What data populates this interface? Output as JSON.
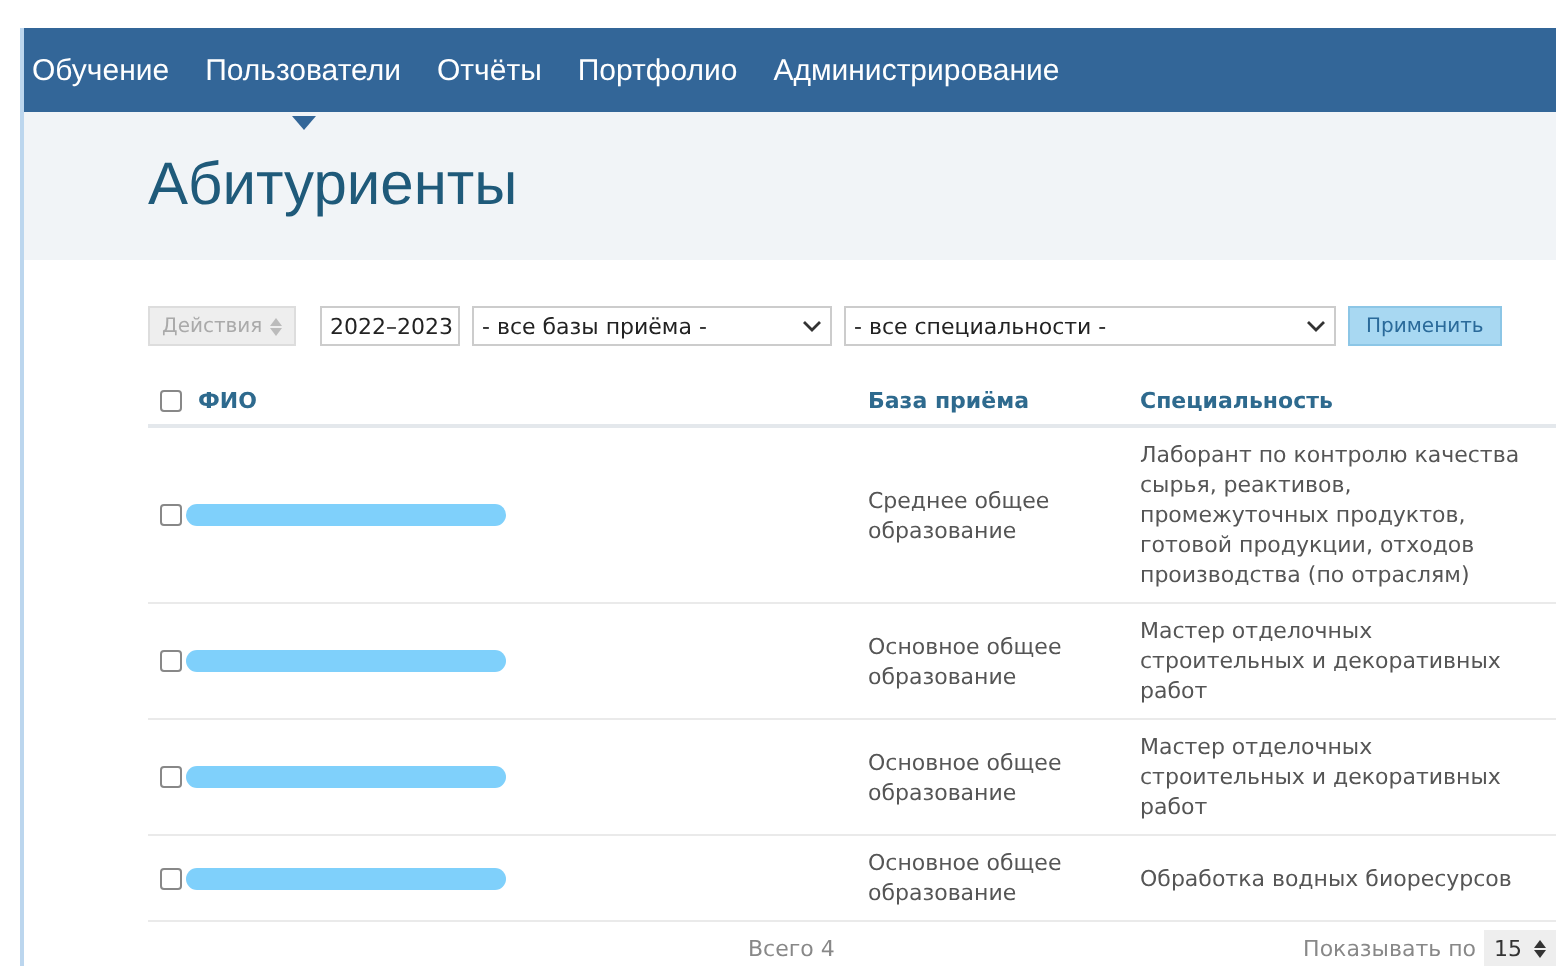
{
  "nav": [
    {
      "label": "Обучение",
      "selected": false
    },
    {
      "label": "Пользователи",
      "selected": true
    },
    {
      "label": "Отчёты",
      "selected": false
    },
    {
      "label": "Портфолио",
      "selected": false
    },
    {
      "label": "Администрирование",
      "selected": false
    }
  ],
  "title": "Абитуриенты",
  "filters": {
    "actions": {
      "label": "Действия",
      "disabled": true
    },
    "year": "2022–2023",
    "base": "- все базы приёма -",
    "specialty": "- все специальности -",
    "apply": "Применить"
  },
  "table": {
    "select_all_checked": false,
    "columns": [
      "ФИО",
      "База приёма",
      "Специальность"
    ],
    "rows": [
      {
        "checked": false,
        "base": "Среднее общее образование",
        "specialty": "Лаборант по контролю качества сырья, реактивов, промежуточных продуктов, готовой продукции, отходов производства (по отраслям)"
      },
      {
        "checked": false,
        "base": "Основное общее образование",
        "specialty": "Мастер отделочных строительных и декоративных работ"
      },
      {
        "checked": false,
        "base": "Основное общее образование",
        "specialty": "Мастер отделочных строительных и декоративных работ"
      },
      {
        "checked": false,
        "base": "Основное общее образование",
        "specialty": "Обработка водных биоресурсов"
      }
    ]
  },
  "footer": {
    "total": "Всего 4",
    "per_page_label": "Показывать по",
    "per_page": "15"
  }
}
